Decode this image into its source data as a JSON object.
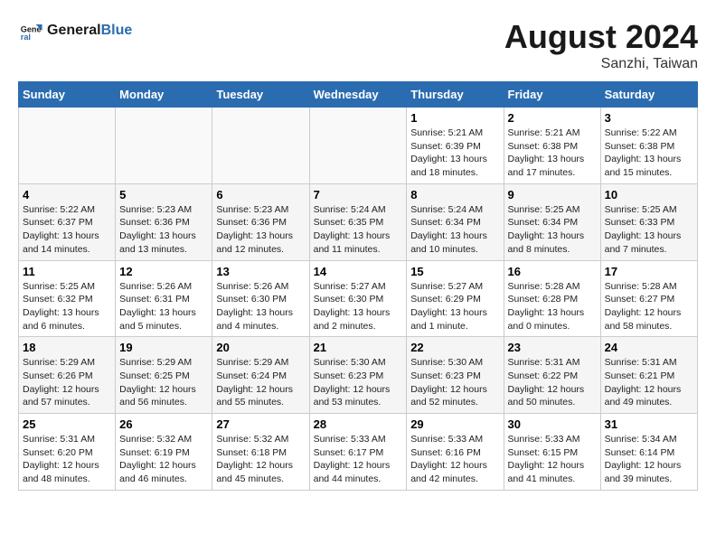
{
  "logo": {
    "line1": "General",
    "line2": "Blue"
  },
  "title": {
    "month_year": "August 2024",
    "location": "Sanzhi, Taiwan"
  },
  "weekdays": [
    "Sunday",
    "Monday",
    "Tuesday",
    "Wednesday",
    "Thursday",
    "Friday",
    "Saturday"
  ],
  "weeks": [
    [
      {
        "day": "",
        "info": ""
      },
      {
        "day": "",
        "info": ""
      },
      {
        "day": "",
        "info": ""
      },
      {
        "day": "",
        "info": ""
      },
      {
        "day": "1",
        "info": "Sunrise: 5:21 AM\nSunset: 6:39 PM\nDaylight: 13 hours\nand 18 minutes."
      },
      {
        "day": "2",
        "info": "Sunrise: 5:21 AM\nSunset: 6:38 PM\nDaylight: 13 hours\nand 17 minutes."
      },
      {
        "day": "3",
        "info": "Sunrise: 5:22 AM\nSunset: 6:38 PM\nDaylight: 13 hours\nand 15 minutes."
      }
    ],
    [
      {
        "day": "4",
        "info": "Sunrise: 5:22 AM\nSunset: 6:37 PM\nDaylight: 13 hours\nand 14 minutes."
      },
      {
        "day": "5",
        "info": "Sunrise: 5:23 AM\nSunset: 6:36 PM\nDaylight: 13 hours\nand 13 minutes."
      },
      {
        "day": "6",
        "info": "Sunrise: 5:23 AM\nSunset: 6:36 PM\nDaylight: 13 hours\nand 12 minutes."
      },
      {
        "day": "7",
        "info": "Sunrise: 5:24 AM\nSunset: 6:35 PM\nDaylight: 13 hours\nand 11 minutes."
      },
      {
        "day": "8",
        "info": "Sunrise: 5:24 AM\nSunset: 6:34 PM\nDaylight: 13 hours\nand 10 minutes."
      },
      {
        "day": "9",
        "info": "Sunrise: 5:25 AM\nSunset: 6:34 PM\nDaylight: 13 hours\nand 8 minutes."
      },
      {
        "day": "10",
        "info": "Sunrise: 5:25 AM\nSunset: 6:33 PM\nDaylight: 13 hours\nand 7 minutes."
      }
    ],
    [
      {
        "day": "11",
        "info": "Sunrise: 5:25 AM\nSunset: 6:32 PM\nDaylight: 13 hours\nand 6 minutes."
      },
      {
        "day": "12",
        "info": "Sunrise: 5:26 AM\nSunset: 6:31 PM\nDaylight: 13 hours\nand 5 minutes."
      },
      {
        "day": "13",
        "info": "Sunrise: 5:26 AM\nSunset: 6:30 PM\nDaylight: 13 hours\nand 4 minutes."
      },
      {
        "day": "14",
        "info": "Sunrise: 5:27 AM\nSunset: 6:30 PM\nDaylight: 13 hours\nand 2 minutes."
      },
      {
        "day": "15",
        "info": "Sunrise: 5:27 AM\nSunset: 6:29 PM\nDaylight: 13 hours\nand 1 minute."
      },
      {
        "day": "16",
        "info": "Sunrise: 5:28 AM\nSunset: 6:28 PM\nDaylight: 13 hours\nand 0 minutes."
      },
      {
        "day": "17",
        "info": "Sunrise: 5:28 AM\nSunset: 6:27 PM\nDaylight: 12 hours\nand 58 minutes."
      }
    ],
    [
      {
        "day": "18",
        "info": "Sunrise: 5:29 AM\nSunset: 6:26 PM\nDaylight: 12 hours\nand 57 minutes."
      },
      {
        "day": "19",
        "info": "Sunrise: 5:29 AM\nSunset: 6:25 PM\nDaylight: 12 hours\nand 56 minutes."
      },
      {
        "day": "20",
        "info": "Sunrise: 5:29 AM\nSunset: 6:24 PM\nDaylight: 12 hours\nand 55 minutes."
      },
      {
        "day": "21",
        "info": "Sunrise: 5:30 AM\nSunset: 6:23 PM\nDaylight: 12 hours\nand 53 minutes."
      },
      {
        "day": "22",
        "info": "Sunrise: 5:30 AM\nSunset: 6:23 PM\nDaylight: 12 hours\nand 52 minutes."
      },
      {
        "day": "23",
        "info": "Sunrise: 5:31 AM\nSunset: 6:22 PM\nDaylight: 12 hours\nand 50 minutes."
      },
      {
        "day": "24",
        "info": "Sunrise: 5:31 AM\nSunset: 6:21 PM\nDaylight: 12 hours\nand 49 minutes."
      }
    ],
    [
      {
        "day": "25",
        "info": "Sunrise: 5:31 AM\nSunset: 6:20 PM\nDaylight: 12 hours\nand 48 minutes."
      },
      {
        "day": "26",
        "info": "Sunrise: 5:32 AM\nSunset: 6:19 PM\nDaylight: 12 hours\nand 46 minutes."
      },
      {
        "day": "27",
        "info": "Sunrise: 5:32 AM\nSunset: 6:18 PM\nDaylight: 12 hours\nand 45 minutes."
      },
      {
        "day": "28",
        "info": "Sunrise: 5:33 AM\nSunset: 6:17 PM\nDaylight: 12 hours\nand 44 minutes."
      },
      {
        "day": "29",
        "info": "Sunrise: 5:33 AM\nSunset: 6:16 PM\nDaylight: 12 hours\nand 42 minutes."
      },
      {
        "day": "30",
        "info": "Sunrise: 5:33 AM\nSunset: 6:15 PM\nDaylight: 12 hours\nand 41 minutes."
      },
      {
        "day": "31",
        "info": "Sunrise: 5:34 AM\nSunset: 6:14 PM\nDaylight: 12 hours\nand 39 minutes."
      }
    ]
  ]
}
